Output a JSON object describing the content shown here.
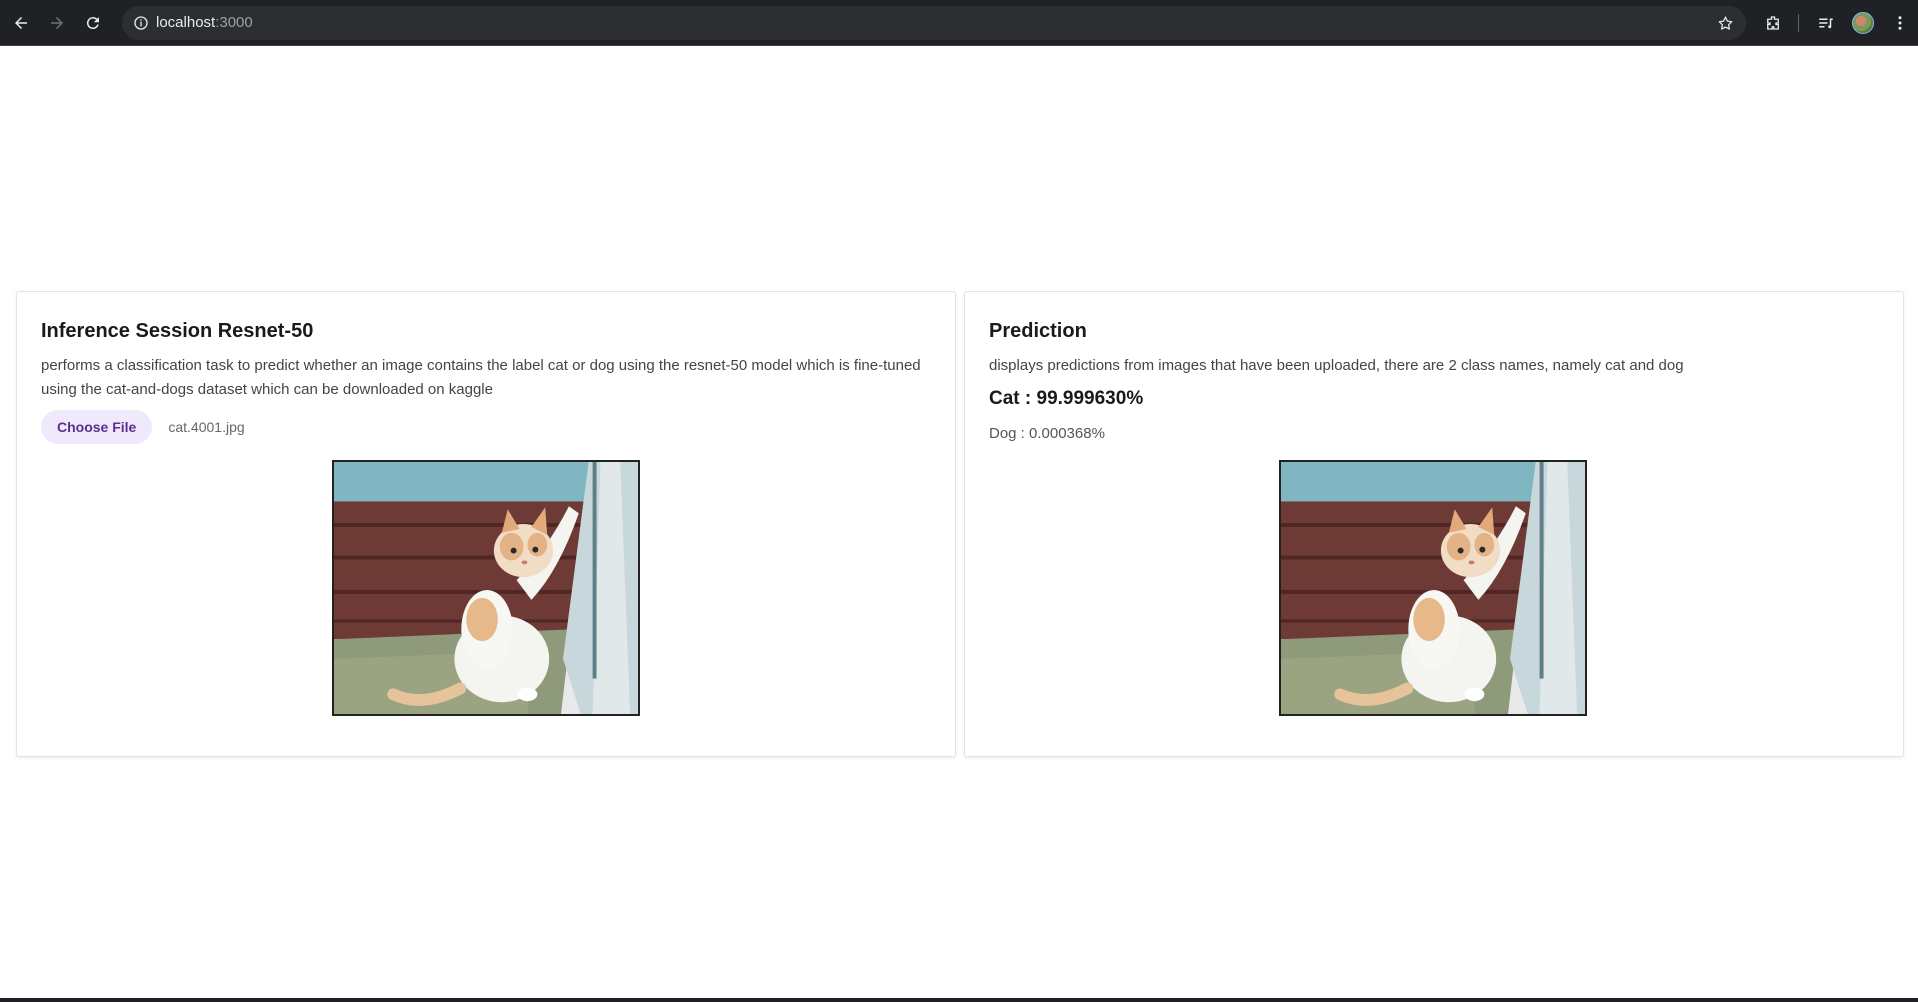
{
  "browser": {
    "url_host": "localhost",
    "url_port": ":3000",
    "icons": [
      "back-arrow-icon",
      "forward-arrow-icon",
      "reload-icon",
      "site-info-icon",
      "bookmark-star-icon",
      "extensions-icon",
      "media-controls-icon",
      "profile-avatar-icon",
      "menu-dots-icon"
    ]
  },
  "inference": {
    "title": "Inference Session Resnet-50",
    "description": "performs a classification task to predict whether an image contains the label cat or dog using the resnet-50 model which is fine-tuned using the cat-and-dogs dataset which can be downloaded on kaggle",
    "choose_file_label": "Choose File",
    "file_name": "cat.4001.jpg"
  },
  "prediction": {
    "title": "Prediction",
    "description": "displays predictions from images that have been uploaded, there are 2 class names, namely cat and dog",
    "top_result": "Cat : 99.999630%",
    "other_result": "Dog : 0.000368%"
  },
  "colors": {
    "chrome_bg": "#202124",
    "accent_button_bg": "#efe9fb",
    "accent_button_text": "#5b2f8f"
  }
}
